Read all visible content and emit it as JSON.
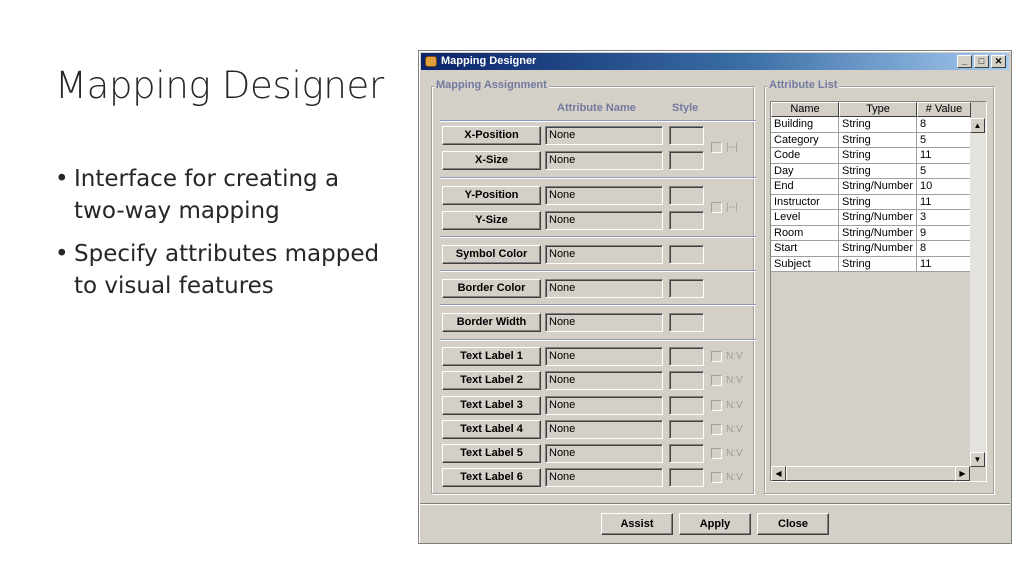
{
  "slide": {
    "title": "Mapping Designer",
    "bullets": [
      "Interface for creating a two-way mapping",
      "Specify attributes mapped to visual features"
    ]
  },
  "window": {
    "title": "Mapping Designer",
    "buttons": {
      "minimize": "_",
      "maximize": "□",
      "close": "✕"
    }
  },
  "mapping": {
    "group_label": "Mapping Assignment",
    "col_attribute": "Attribute Name",
    "col_style": "Style",
    "rows": [
      {
        "label": "X-Position",
        "value": "None"
      },
      {
        "label": "X-Size",
        "value": "None"
      },
      {
        "label": "Y-Position",
        "value": "None"
      },
      {
        "label": "Y-Size",
        "value": "None"
      },
      {
        "label": "Symbol Color",
        "value": "None"
      },
      {
        "label": "Border Color",
        "value": "None"
      },
      {
        "label": "Border Width",
        "value": "None"
      },
      {
        "label": "Text Label 1",
        "value": "None"
      },
      {
        "label": "Text Label 2",
        "value": "None"
      },
      {
        "label": "Text Label 3",
        "value": "None"
      },
      {
        "label": "Text Label 4",
        "value": "None"
      },
      {
        "label": "Text Label 5",
        "value": "None"
      },
      {
        "label": "Text Label 6",
        "value": "None"
      }
    ],
    "x_check_label": "|--|",
    "y_check_label": "|--|",
    "nv_label": "N:V"
  },
  "attributes": {
    "group_label": "Attribute List",
    "columns": [
      "Name",
      "Type",
      "# Value"
    ],
    "rows": [
      [
        "Building",
        "String",
        "8"
      ],
      [
        "Category",
        "String",
        "5"
      ],
      [
        "Code",
        "String",
        "11"
      ],
      [
        "Day",
        "String",
        "5"
      ],
      [
        "End",
        "String/Number",
        "10"
      ],
      [
        "Instructor",
        "String",
        "11"
      ],
      [
        "Level",
        "String/Number",
        "3"
      ],
      [
        "Room",
        "String/Number",
        "9"
      ],
      [
        "Start",
        "String/Number",
        "8"
      ],
      [
        "Subject",
        "String",
        "11"
      ]
    ]
  },
  "footer": {
    "assist": "Assist",
    "apply": "Apply",
    "close": "Close"
  }
}
